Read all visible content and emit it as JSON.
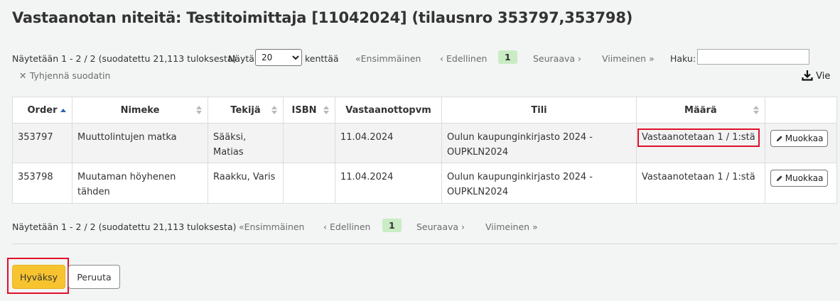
{
  "page": {
    "title": "Vastaanotan niteitä: Testitoimittaja [11042024] (tilausnro 353797,353798)"
  },
  "colors": {
    "primary_button": "#f7c32f",
    "current_page": "#c9ecc4",
    "highlight": "#e0102a",
    "sort_active": "#2a62b0"
  },
  "pager_top": {
    "info": "Näytetään 1 - 2 / 2 (suodatettu 21,113 tuloksesta)",
    "show_label": "Näytä",
    "length_value": "20",
    "entries_label": "kenttää",
    "first": "Ensimmäinen",
    "prev": "Edellinen",
    "current": "1",
    "next": "Seuraava",
    "last": "Viimeinen",
    "search_label": "Haku:",
    "search_value": "",
    "clear_filter": "Tyhjennä suodatin",
    "export": "Vie"
  },
  "table": {
    "headers": [
      "Order",
      "Nimeke",
      "Tekijä",
      "ISBN",
      "Vastaanottopvm",
      "Tili",
      "Määrä",
      ""
    ],
    "rows": [
      {
        "order": "353797",
        "title": "Muuttolintujen matka",
        "author": "Sääksi, Matias",
        "isbn": "",
        "received": "11.04.2024",
        "fund": "Oulun kaupunginkirjasto 2024 - OUPKLN2024",
        "quantity": "Vastaanotetaan 1 / 1:stä",
        "edit": "Muokkaa"
      },
      {
        "order": "353798",
        "title": "Muutaman höyhenen tähden",
        "author": "Raakku, Varis",
        "isbn": "",
        "received": "11.04.2024",
        "fund": "Oulun kaupunginkirjasto 2024 - OUPKLN2024",
        "quantity": "Vastaanotetaan 1 / 1:stä",
        "edit": "Muokkaa"
      }
    ]
  },
  "pager_bottom": {
    "info": "Näytetään 1 - 2 / 2 (suodatettu 21,113 tuloksesta)",
    "first": "Ensimmäinen",
    "prev": "Edellinen",
    "current": "1",
    "next": "Seuraava",
    "last": "Viimeinen"
  },
  "actions": {
    "confirm": "Hyväksy",
    "cancel": "Peruuta"
  }
}
